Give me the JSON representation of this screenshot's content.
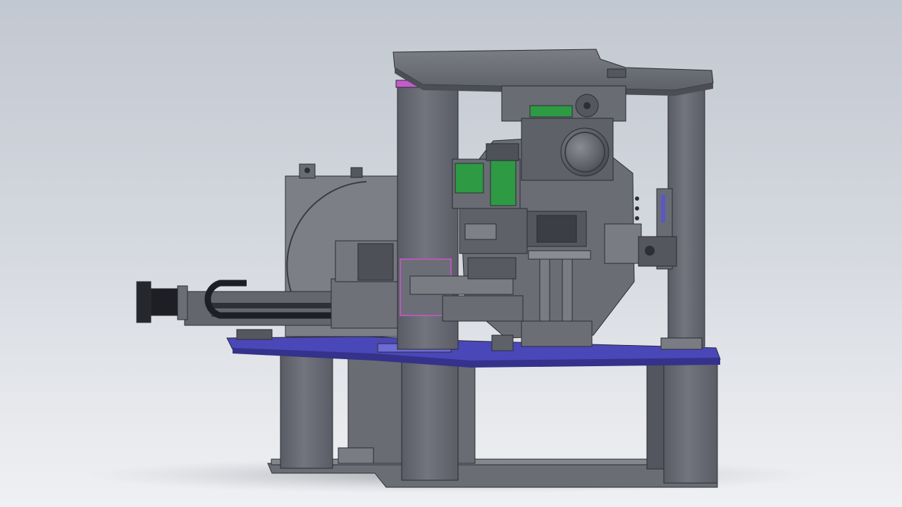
{
  "scene": {
    "background_top": "#c2c8d1",
    "background_bottom": "#eff0f3",
    "frame_color": "#5e6170",
    "plate_color": "#6e7077",
    "column_color": "#676973",
    "highlight_blue": "#5b57c4",
    "highlight_magenta": "#c45bc8",
    "component_green": "#2e9a44",
    "motor_color": "#1c1d22"
  }
}
